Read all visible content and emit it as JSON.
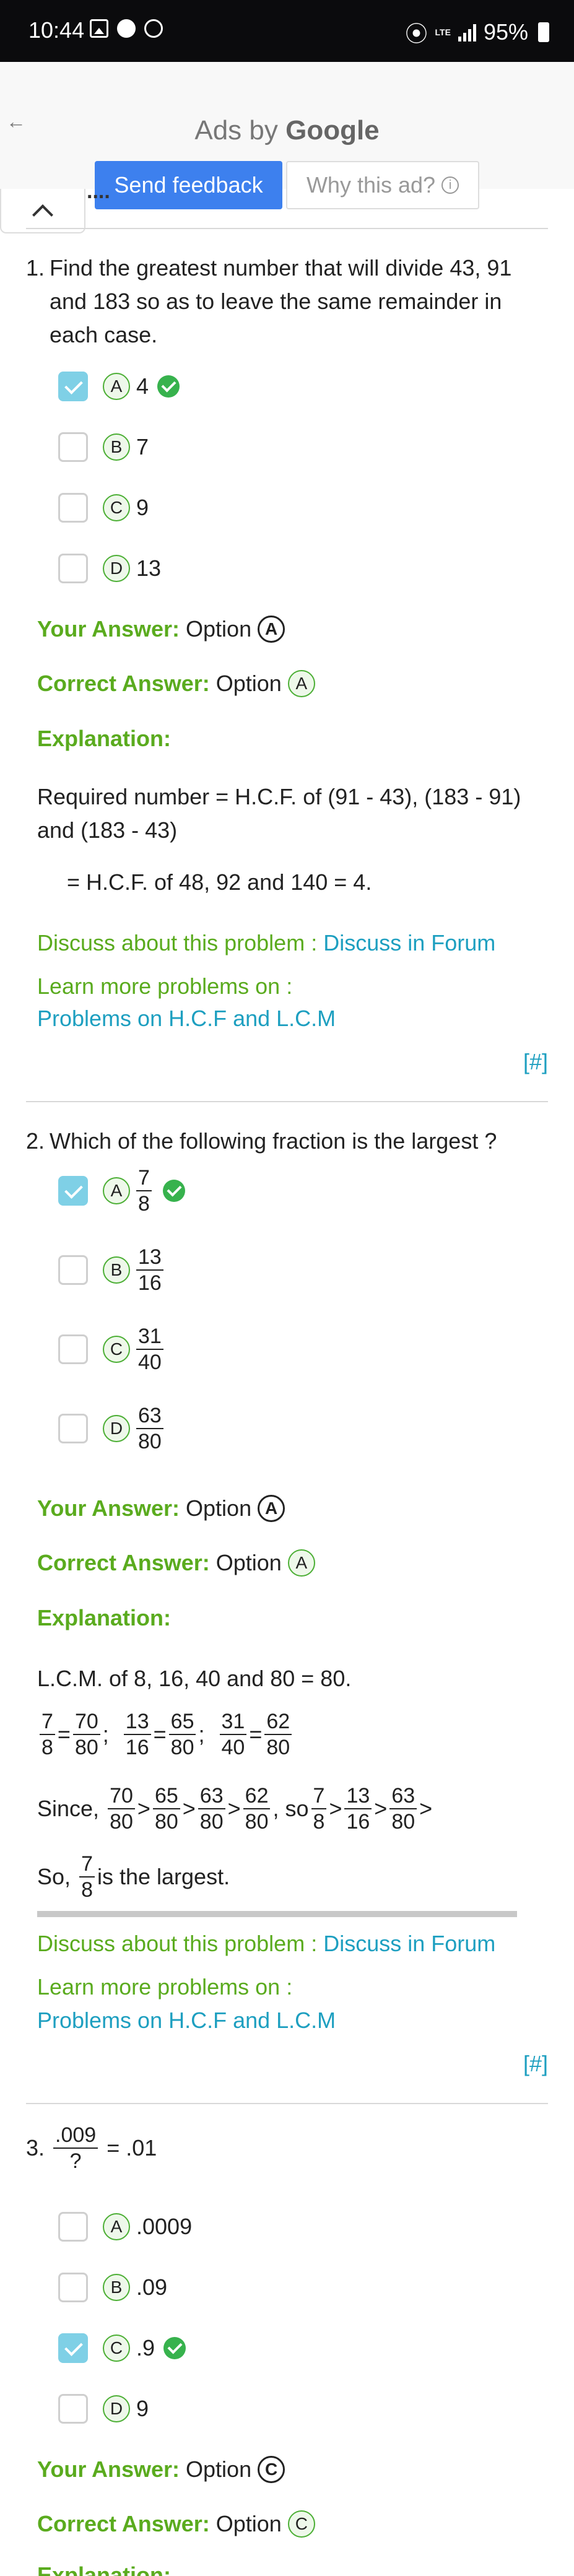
{
  "status_bar": {
    "time": "10:44",
    "battery": "95%",
    "network_label": "LTE"
  },
  "ad": {
    "ads_by": "Ads by",
    "google": "Google",
    "send_feedback": "Send feedback",
    "why_this_ad": "Why this ad?",
    "cut_heading": "...."
  },
  "questions": [
    {
      "number": "1.",
      "text": "Find the greatest number that will divide 43, 91 and 183 so as to leave the same remainder in each case.",
      "options": [
        {
          "letter": "A",
          "value": "4",
          "checked": true,
          "correct": true
        },
        {
          "letter": "B",
          "value": "7",
          "checked": false,
          "correct": false
        },
        {
          "letter": "C",
          "value": "9",
          "checked": false,
          "correct": false
        },
        {
          "letter": "D",
          "value": "13",
          "checked": false,
          "correct": false
        }
      ],
      "your_answer_label": "Your Answer:",
      "your_answer_text": "Option",
      "your_answer_letter": "A",
      "correct_answer_label": "Correct Answer:",
      "correct_answer_text": "Option",
      "correct_answer_letter": "A",
      "explanation_label": "Explanation:",
      "explanation_1": "Required number = H.C.F. of (91 - 43), (183 - 91) and (183 - 43)",
      "explanation_2": "= H.C.F. of 48, 92 and 140 = 4.",
      "discuss_text": "Discuss about this problem :",
      "discuss_link": "Discuss in Forum",
      "learn_text": "Learn more problems on :",
      "learn_link": "Problems on H.C.F and L.C.M",
      "hash": "[#]"
    },
    {
      "number": "2.",
      "text": "Which of the following fraction is the largest ?",
      "options": [
        {
          "letter": "A",
          "num": "7",
          "den": "8",
          "checked": true,
          "correct": true
        },
        {
          "letter": "B",
          "num": "13",
          "den": "16",
          "checked": false,
          "correct": false
        },
        {
          "letter": "C",
          "num": "31",
          "den": "40",
          "checked": false,
          "correct": false
        },
        {
          "letter": "D",
          "num": "63",
          "den": "80",
          "checked": false,
          "correct": false
        }
      ],
      "your_answer_label": "Your Answer:",
      "your_answer_text": "Option",
      "your_answer_letter": "A",
      "correct_answer_label": "Correct Answer:",
      "correct_answer_text": "Option",
      "correct_answer_letter": "A",
      "explanation_label": "Explanation:",
      "explanation_1": "L.C.M. of 8, 16, 40 and 80 = 80.",
      "eq": {
        "f1": [
          "7",
          "8"
        ],
        "f1b": [
          "70",
          "80"
        ],
        "f2": [
          "13",
          "16"
        ],
        "f2b": [
          "65",
          "80"
        ],
        "f3": [
          "31",
          "40"
        ],
        "f3b": [
          "62",
          "80"
        ]
      },
      "since_text": "Since,",
      "so_text": ", so",
      "since_a": [
        [
          "70",
          "80"
        ],
        [
          "65",
          "80"
        ],
        [
          "63",
          "80"
        ],
        [
          "62",
          "80"
        ]
      ],
      "since_b": [
        [
          "7",
          "8"
        ],
        [
          "13",
          "16"
        ],
        [
          "63",
          "80"
        ]
      ],
      "conclusion_prefix": "So,",
      "conclusion_frac": [
        "7",
        "8"
      ],
      "conclusion_suffix": "is the largest.",
      "discuss_text": "Discuss about this problem :",
      "discuss_link": "Discuss in Forum",
      "learn_text": "Learn more problems on :",
      "learn_link": "Problems on H.C.F and L.C.M",
      "hash": "[#]"
    },
    {
      "number": "3.",
      "frac_num": ".009",
      "frac_den": "?",
      "rhs": "= .01",
      "options": [
        {
          "letter": "A",
          "value": ".0009",
          "checked": false,
          "correct": false
        },
        {
          "letter": "B",
          "value": ".09",
          "checked": false,
          "correct": false
        },
        {
          "letter": "C",
          "value": ".9",
          "checked": true,
          "correct": true
        },
        {
          "letter": "D",
          "value": "9",
          "checked": false,
          "correct": false
        }
      ],
      "your_answer_label": "Your Answer:",
      "your_answer_text": "Option",
      "your_answer_letter": "C",
      "correct_answer_label": "Correct Answer:",
      "correct_answer_text": "Option",
      "correct_answer_letter": "C",
      "explanation_label": "Explanation:"
    }
  ]
}
